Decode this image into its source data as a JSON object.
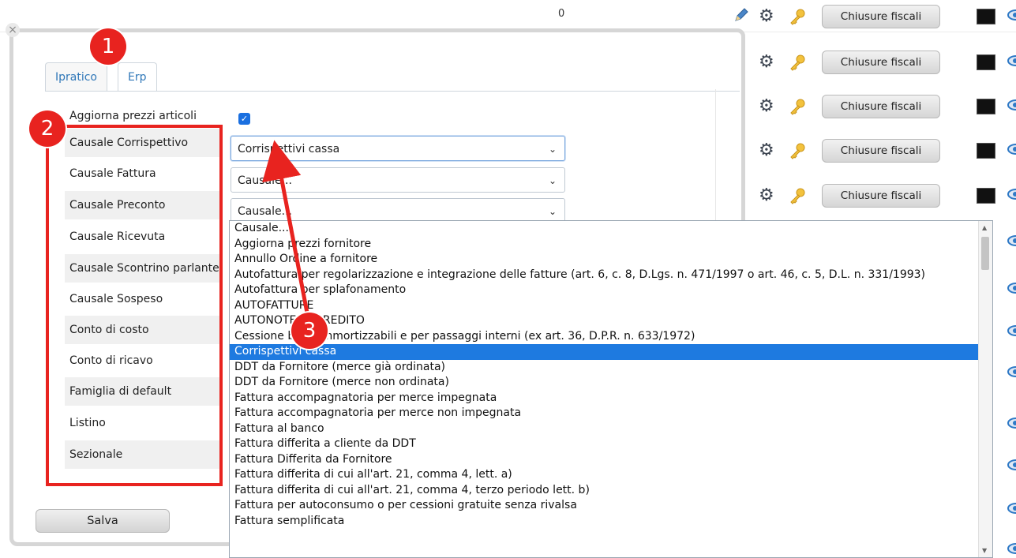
{
  "background": {
    "zero_value": "0",
    "chiusure_label": "Chiusure fiscali",
    "row_icons": [
      "pencil-icon",
      "gear-icon",
      "key-icon",
      "terminal-icon",
      "eye-icon"
    ]
  },
  "dialog": {
    "close_glyph": "×",
    "tabs": [
      {
        "label": "Ipratico",
        "active": false
      },
      {
        "label": "Erp",
        "active": true
      }
    ],
    "fields": [
      "Aggiorna prezzi articoli",
      "Causale Corrispettivo",
      "Causale Fattura",
      "Causale Preconto",
      "Causale Ricevuta",
      "Causale Scontrino parlante",
      "Causale Sospeso",
      "Conto di costo",
      "Conto di ricavo",
      "Famiglia di default",
      "Listino",
      "Sezionale"
    ],
    "aggiorna_checked": true,
    "selects": [
      {
        "value": "Corrispettivi cassa"
      },
      {
        "value": "Causale..."
      },
      {
        "value": "Causale..."
      }
    ],
    "save_label": "Salva"
  },
  "dropdown": {
    "selected_index": 8,
    "options": [
      "Causale...",
      "Aggiorna prezzi fornitore",
      "Annullo Ordine a fornitore",
      "Autofattura per regolarizzazione e integrazione delle fatture (art. 6, c. 8, D.Lgs. n. 471/1997 o art. 46, c. 5, D.L. n. 331/1993)",
      "Autofattura per splafonamento",
      "AUTOFATTURE",
      "AUTONOTE DI CREDITO",
      "Cessione beni ammortizzabili e per passaggi interni (ex art. 36, D.P.R. n. 633/1972)",
      "Corrispettivi cassa",
      "DDT da Fornitore (merce già ordinata)",
      "DDT da Fornitore (merce non ordinata)",
      "Fattura accompagnatoria per merce impegnata",
      "Fattura accompagnatoria per merce non impegnata",
      "Fattura al banco",
      "Fattura differita a cliente da DDT",
      "Fattura Differita da Fornitore",
      "Fattura differita di cui all'art. 21, comma 4, lett. a)",
      "Fattura differita di cui all'art. 21, comma 4, terzo periodo lett. b)",
      "Fattura per autoconsumo o per cessioni gratuite senza rivalsa",
      "Fattura semplificata"
    ]
  },
  "annotations": {
    "badges": [
      "1",
      "2",
      "3"
    ],
    "accent_color": "#e8231f"
  }
}
